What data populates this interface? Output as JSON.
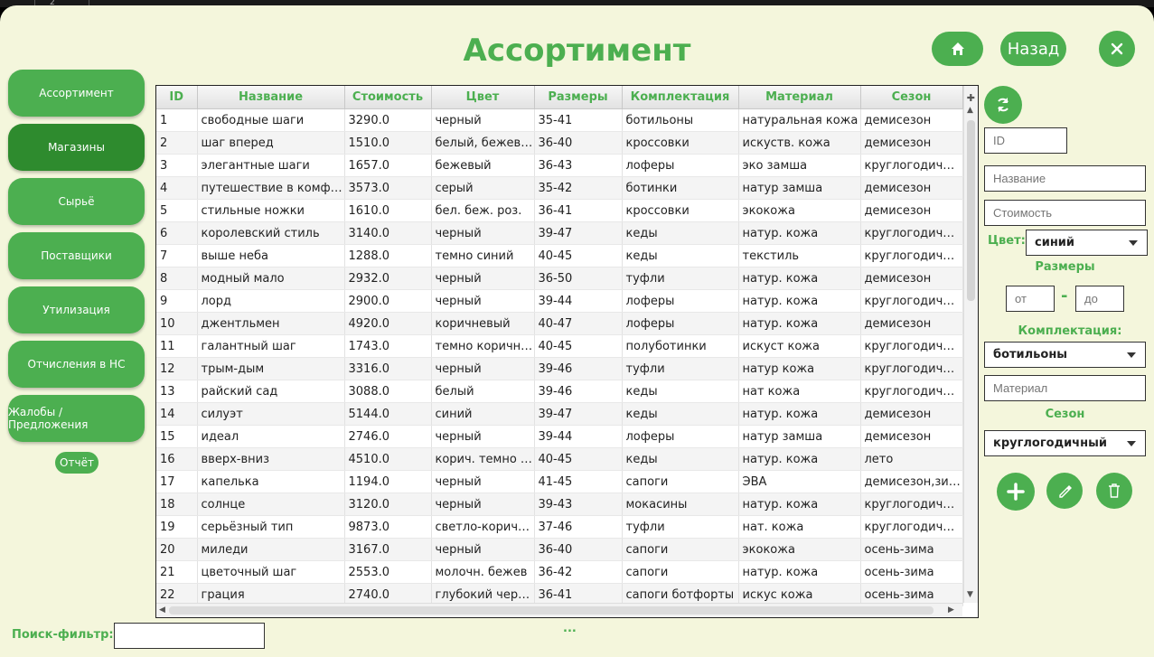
{
  "top_strip_text": "2",
  "header": {
    "title": "Ассортимент",
    "back_label": "Назад"
  },
  "sidebar": {
    "items": [
      {
        "label": "Ассортимент"
      },
      {
        "label": "Магазины"
      },
      {
        "label": "Сырьё"
      },
      {
        "label": "Поставщики"
      },
      {
        "label": "Утилизация"
      },
      {
        "label": "Отчисления в НС"
      },
      {
        "label": "Жалобы / Предложения"
      }
    ],
    "report_label": "Отчёт"
  },
  "table": {
    "columns": [
      "ID",
      "Название",
      "Стоимость",
      "Цвет",
      "Размеры",
      "Комплектация",
      "Материал",
      "Сезон"
    ],
    "rows": [
      [
        "1",
        "свободные шаги",
        "3290.0",
        "черный",
        "35-41",
        "ботильоны",
        "натуральная кожа",
        "демисезон"
      ],
      [
        "2",
        "шаг вперед",
        "1510.0",
        "белый, бежевый",
        "36-40",
        "кроссовки",
        "искуств. кожа",
        "демисезон"
      ],
      [
        "3",
        "элегантные шаги",
        "1657.0",
        "бежевый",
        "36-43",
        "лоферы",
        "эко замша",
        "круглогодичный"
      ],
      [
        "4",
        "путешествие в комфорте",
        "3573.0",
        "серый",
        "35-42",
        "ботинки",
        "натур замша",
        "демисезон"
      ],
      [
        "5",
        "стильные ножки",
        "1610.0",
        "бел. беж. роз.",
        "36-41",
        "кроссовки",
        "экокожа",
        "демисезон"
      ],
      [
        "6",
        "королевский стиль",
        "3140.0",
        "черный",
        "39-47",
        "кеды",
        "натур. кожа",
        "круглогодичный"
      ],
      [
        "7",
        "выше неба",
        "1288.0",
        "темно синий",
        "40-45",
        "кеды",
        "текстиль",
        "круглогодичный"
      ],
      [
        "8",
        "модный мало",
        "2932.0",
        "черный",
        "36-50",
        "туфли",
        "натур. кожа",
        "демисезон"
      ],
      [
        "9",
        "лорд",
        "2900.0",
        "черный",
        "39-44",
        "лоферы",
        "натур. кожа",
        "круглогодичный"
      ],
      [
        "10",
        "джентльмен",
        "4920.0",
        "коричневый",
        "40-47",
        "лоферы",
        "натур. кожа",
        "демисезон"
      ],
      [
        "11",
        "галантный шаг",
        "1743.0",
        "темно коричне...",
        "40-45",
        "полуботинки",
        "искуст кожа",
        "круглогодичный"
      ],
      [
        "12",
        "трым-дым",
        "3316.0",
        "черный",
        "39-46",
        "туфли",
        "натур кожа",
        "круглогодичный"
      ],
      [
        "13",
        "райский сад",
        "3088.0",
        "белый",
        "39-46",
        "кеды",
        "нат кожа",
        "круглогодичный"
      ],
      [
        "14",
        "силуэт",
        "5144.0",
        "синий",
        "39-47",
        "кеды",
        "натур. кожа",
        "демисезон"
      ],
      [
        "15",
        "идеал",
        "2746.0",
        "черный",
        "39-44",
        "лоферы",
        "натур замша",
        "демисезон"
      ],
      [
        "16",
        "вверх-вниз",
        "4510.0",
        "корич. темно ко...",
        "40-45",
        "кеды",
        "натур. кожа",
        "лето"
      ],
      [
        "17",
        "капелька",
        "1194.0",
        "черный",
        "41-45",
        "сапоги",
        "ЭВА",
        "демисезон,зима,"
      ],
      [
        "18",
        "солнце",
        "3120.0",
        "черный",
        "39-43",
        "мокасины",
        "натур. кожа",
        "круглогодичный"
      ],
      [
        "19",
        "серьёзный тип",
        "9873.0",
        "светло-коричне...",
        "37-46",
        "туфли",
        "нат. кожа",
        "круглогодичный"
      ],
      [
        "20",
        "миледи",
        "3167.0",
        "черный",
        "36-40",
        "сапоги",
        "экокожа",
        "осень-зима"
      ],
      [
        "21",
        "цветочный шаг",
        "2553.0",
        "молочн. бежев",
        "36-42",
        "сапоги",
        "натур. кожа",
        "осень-зима"
      ],
      [
        "22",
        "грация",
        "2740.0",
        "глубокий черный",
        "36-41",
        "сапоги ботфорты",
        "искус кожа",
        "осень-зима"
      ]
    ]
  },
  "form": {
    "id_placeholder": "ID",
    "name_placeholder": "Название",
    "cost_placeholder": "Стоимость",
    "color_label": "Цвет:",
    "color_value": "синий",
    "sizes_label": "Размеры",
    "size_from_placeholder": "от",
    "size_dash": "-",
    "size_to_placeholder": "до",
    "equipment_label": "Комплектация:",
    "equipment_value": "ботильоны",
    "material_placeholder": "Материал",
    "season_label": "Сезон",
    "season_value": "круглогодичный"
  },
  "footer": {
    "search_label": "Поиск-фильтр:",
    "search_value": "",
    "status_text": "..."
  },
  "colors": {
    "accent": "#4caf50",
    "accent_dark": "#2e8b2e",
    "background": "#f4f6dc"
  },
  "icons": [
    "home-icon",
    "close-icon",
    "refresh-icon",
    "add-icon",
    "edit-icon",
    "delete-icon"
  ]
}
